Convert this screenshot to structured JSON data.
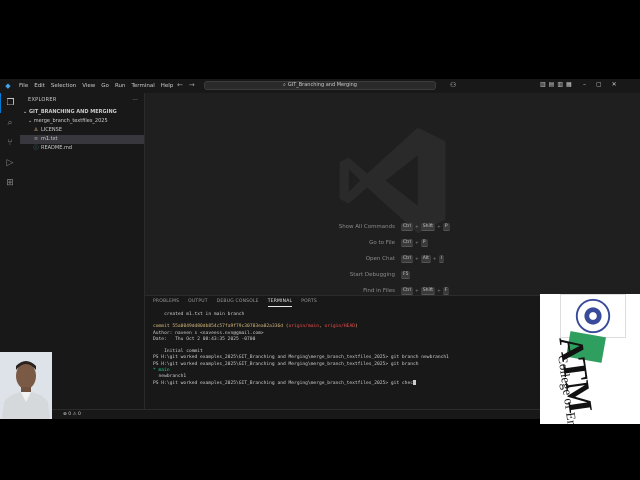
{
  "menu": [
    "File",
    "Edit",
    "Selection",
    "View",
    "Go",
    "Run",
    "Terminal",
    "Help"
  ],
  "command_center": {
    "text": "GIT_Branching and Merging"
  },
  "sidebar": {
    "header": "EXPLORER",
    "root_folder": "GIT_BRANCHING AND MERGING",
    "subfolder": "merge_branch_textfiles_2025",
    "files": [
      {
        "name": "LICENSE",
        "icon": "license-icon"
      },
      {
        "name": "m1.txt",
        "icon": "text-file-icon",
        "selected": true
      },
      {
        "name": "README.md",
        "icon": "markdown-icon"
      }
    ]
  },
  "editor_hints": [
    {
      "label": "Show All Commands",
      "keys": [
        "Ctrl",
        "Shift",
        "P"
      ]
    },
    {
      "label": "Go to File",
      "keys": [
        "Ctrl",
        "P"
      ]
    },
    {
      "label": "Open Chat",
      "keys": [
        "Ctrl",
        "Alt",
        "I"
      ]
    },
    {
      "label": "Start Debugging",
      "keys": [
        "F5"
      ]
    },
    {
      "label": "Find in Files",
      "keys": [
        "Ctrl",
        "Shift",
        "F"
      ]
    }
  ],
  "panel": {
    "tabs": [
      "PROBLEMS",
      "OUTPUT",
      "DEBUG CONSOLE",
      "TERMINAL",
      "PORTS"
    ],
    "active_tab": "TERMINAL"
  },
  "terminal": {
    "line1": "    created m1.txt in main branch",
    "commit_label": "commit ",
    "commit_hash": "55a0049dd80db854c57fa9f79c30703ea02a336d",
    "commit_refs_open": " (",
    "commit_ref_origin": "origin/main",
    "commit_refs_sep": ", ",
    "commit_ref_head": "origin/HEAD",
    "commit_refs_close": ")",
    "author": "Author: naveen s <naveess.nvn@gmail.com>",
    "date": "Date:   Thu Oct 2 08:43:35 2025 -0700",
    "initial": "    Initial commit",
    "ps1": "PS H:\\git worked examples_2025\\GIT_Branching and Merging\\merge_branch_textfiles_2025> git branch newbranch1",
    "ps2": "PS H:\\git worked examples_2025\\GIT_Branching and Merging\\merge_branch_textfiles_2025> git branch",
    "branch_main": "* main",
    "branch_new": "  newbranch1",
    "ps3": "PS H:\\git worked examples_2025\\GIT_Branching and Merging\\merge_branch_textfiles_2025> git chec"
  },
  "statusbar": {
    "problems": "⊗ 0  ⚠ 0"
  },
  "logo": {
    "word": "ATM",
    "sub": "College of Enginee",
    "badge": "atme"
  }
}
